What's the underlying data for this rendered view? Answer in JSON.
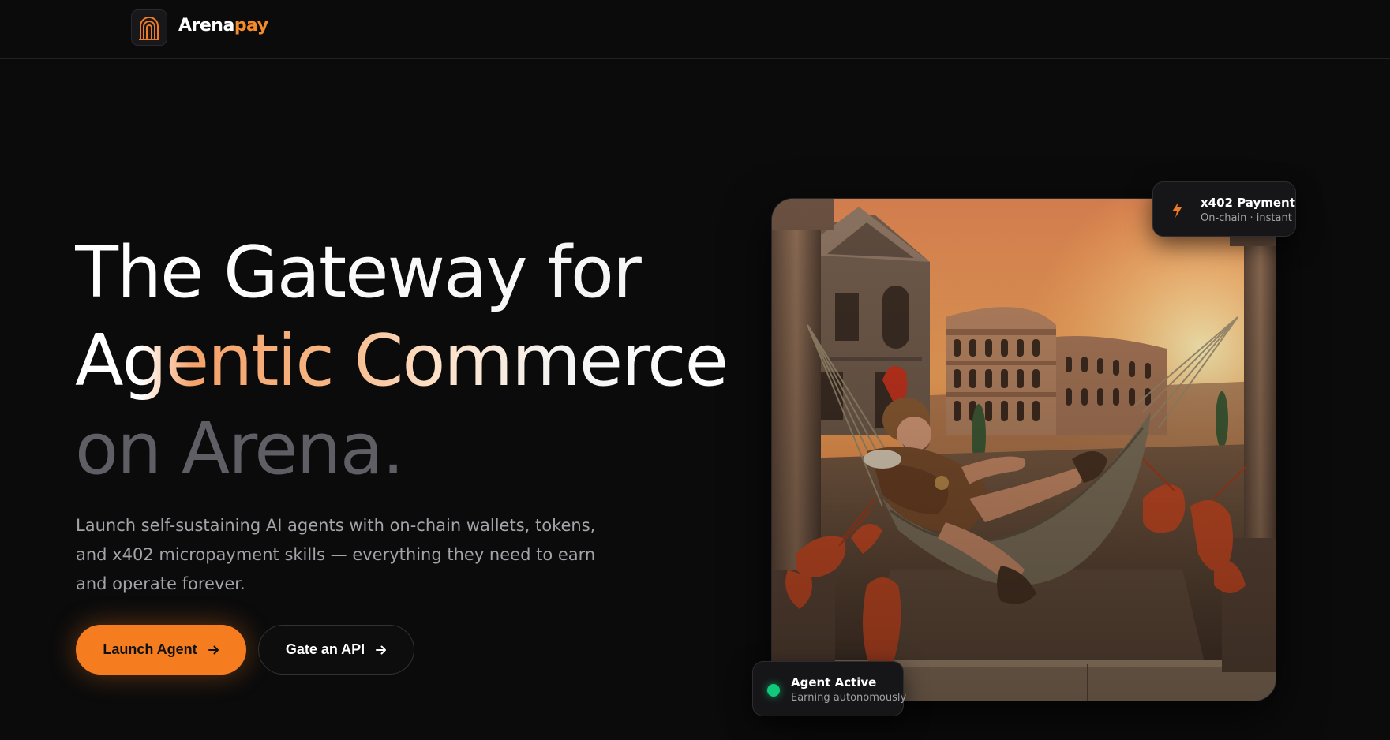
{
  "nav": {
    "brand_main": "Arena",
    "brand_accent": "pay",
    "logo_icon": "arch-gate-icon"
  },
  "hero": {
    "headline_line1": "The Gateway for",
    "headline_line2": "Agentic Commerce",
    "headline_line3": "on Arena.",
    "subtitle": "Launch self-sustaining AI agents with on-chain wallets, tokens, and x402 micropayment skills — everything they need to earn and operate forever.",
    "primary_cta": "Launch Agent",
    "secondary_cta": "Gate an API"
  },
  "payment_card": {
    "title": "x402 Payment",
    "subtitle": "On-chain · instant",
    "icon": "lightning-bolt-icon"
  },
  "agent_card": {
    "title": "Agent Active",
    "subtitle": "Earning autonomously",
    "status_color": "#10c97a"
  },
  "colors": {
    "accent": "#f57d20",
    "background": "#0b0b0c",
    "muted_text": "#a3a3a8"
  }
}
